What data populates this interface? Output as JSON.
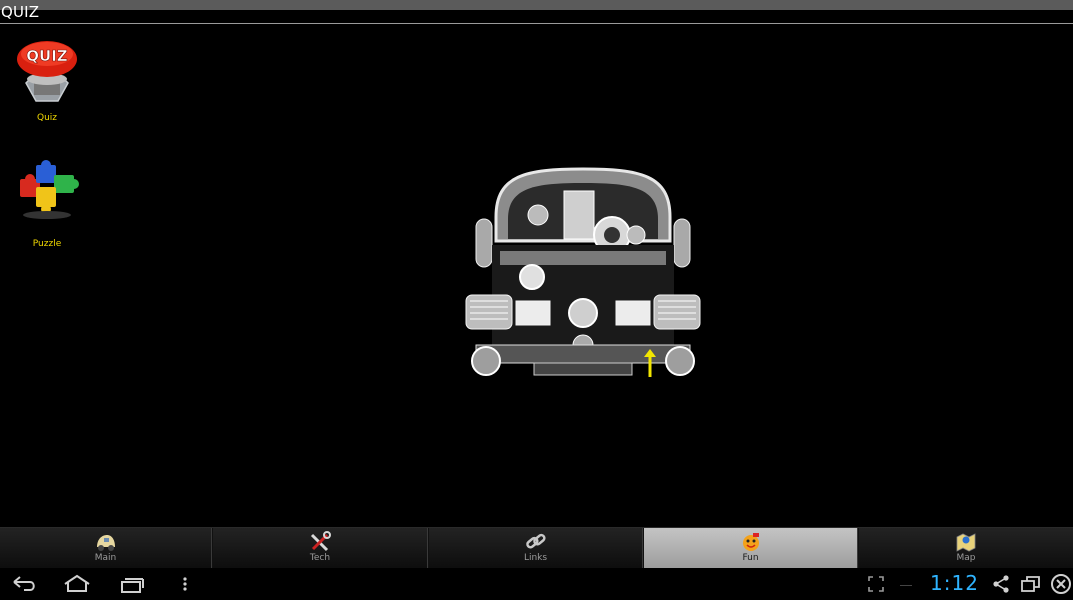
{
  "app": {
    "title": "QUIZ"
  },
  "sidebar": {
    "items": [
      {
        "label": "Quiz",
        "icon": "quiz-button-icon",
        "badge_text": "QUIZ"
      },
      {
        "label": "Puzzle",
        "icon": "puzzle-pieces-icon"
      }
    ]
  },
  "main": {
    "image": "engine-diagram"
  },
  "tabs": [
    {
      "label": "Main",
      "icon": "beetle-car-icon",
      "active": false
    },
    {
      "label": "Tech",
      "icon": "tools-icon",
      "active": false
    },
    {
      "label": "Links",
      "icon": "chain-link-icon",
      "active": false
    },
    {
      "label": "Fun",
      "icon": "fun-face-icon",
      "active": true
    },
    {
      "label": "Map",
      "icon": "map-icon",
      "active": false
    }
  ],
  "system": {
    "clock": "1:12",
    "icons": [
      "back-icon",
      "home-icon",
      "recent-apps-icon",
      "menu-icon",
      "fullscreen-icon",
      "share-icon",
      "window-icon",
      "close-icon"
    ]
  },
  "colors": {
    "label_yellow": "#f2d900",
    "clock_blue": "#2fb4ff",
    "active_tab": "#b0b0b0"
  }
}
